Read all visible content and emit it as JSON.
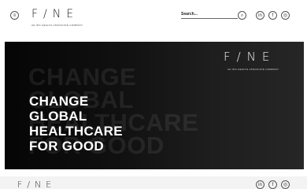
{
  "header": {
    "logo": "F/NE",
    "tagline": "AN IPG HEALTH ASSOCIATE COMPANY",
    "search_label": "Search...",
    "icons": [
      "menu-icon",
      "search-icon",
      "linkedin-icon",
      "facebook-icon",
      "instagram-icon"
    ],
    "menu_glyph": "≡",
    "search_glyph": "⌕",
    "social_glyphs": [
      "in",
      "f",
      "◎"
    ]
  },
  "hero": {
    "logo": "F/NE",
    "tagline": "AN IPG HEALTH ASSOCIATE COMPANY",
    "ghost_lines": [
      "CHANGE",
      "GLOBAL",
      "HEALTHCARE",
      "FOR GOOD"
    ],
    "headline_lines": [
      "CHANGE",
      "GLOBAL",
      "HEALTHCARE",
      "FOR GOOD"
    ]
  },
  "footer": {
    "logo": "F/NE",
    "social_glyphs": [
      "in",
      "f",
      "◎"
    ]
  },
  "colors": {
    "hero_background": "#111111",
    "hero_text": "#ffffff",
    "header_background": "#ffffff"
  }
}
